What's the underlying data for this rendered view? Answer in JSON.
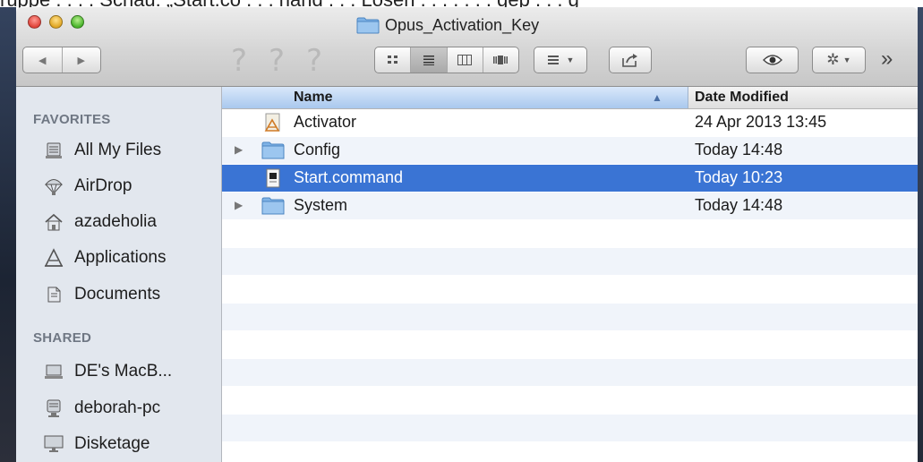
{
  "caption": "ruppe . . . . Schau: „Start.co . . . nand . . . Lösen . . . . . . . gep . . . g",
  "window": {
    "title": "Opus_Activation_Key",
    "colors": {
      "selection": "#3a74d4",
      "sidebar": "#e2e7ee"
    }
  },
  "toolbar": {
    "back_icon": "◀",
    "forward_icon": "▶",
    "q1": "?",
    "q2": "?",
    "q3": "?",
    "overflow": "»"
  },
  "sidebar": {
    "favorites_header": "FAVORITES",
    "favorites": [
      {
        "label": "All My Files",
        "icon": "all-files-icon"
      },
      {
        "label": "AirDrop",
        "icon": "airdrop-icon"
      },
      {
        "label": "azadeholia",
        "icon": "home-icon"
      },
      {
        "label": "Applications",
        "icon": "applications-icon"
      },
      {
        "label": "Documents",
        "icon": "documents-icon"
      }
    ],
    "shared_header": "SHARED",
    "shared": [
      {
        "label": "DE's MacB...",
        "icon": "laptop-icon"
      },
      {
        "label": "deborah-pc",
        "icon": "pc-icon"
      },
      {
        "label": "Disketage",
        "icon": "display-icon"
      }
    ]
  },
  "list": {
    "columns": {
      "name": "Name",
      "date": "Date Modified",
      "sort_icon": "▲"
    },
    "rows": [
      {
        "name": "Activator",
        "date": "24 Apr 2013 13:45",
        "icon": "app-icon",
        "expandable": false
      },
      {
        "name": "Config",
        "date": "Today 14:48",
        "icon": "folder-icon",
        "expandable": true
      },
      {
        "name": "Start.command",
        "date": "Today 10:23",
        "icon": "script-icon",
        "expandable": false,
        "selected": true
      },
      {
        "name": "System",
        "date": "Today 14:48",
        "icon": "folder-icon",
        "expandable": true
      }
    ],
    "disclosure_icon": "▶"
  }
}
